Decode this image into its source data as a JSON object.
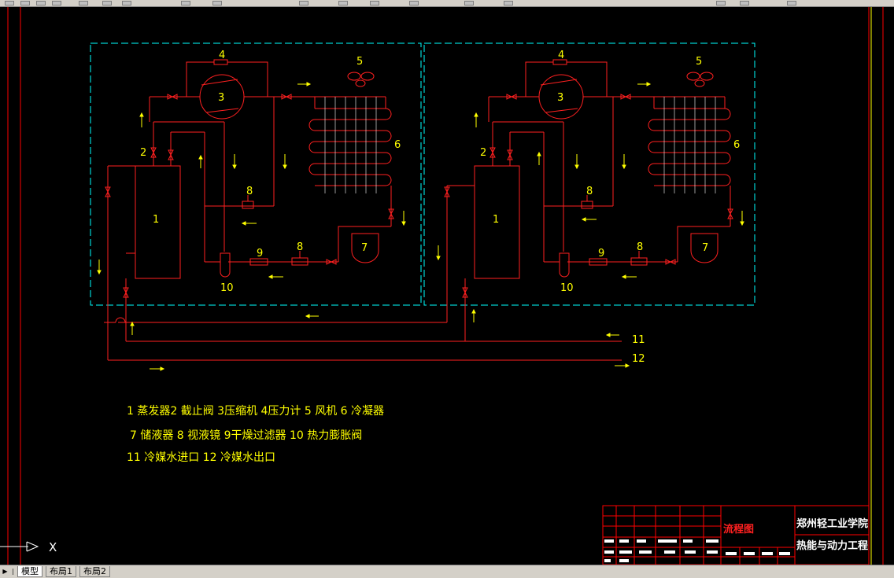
{
  "labels": {
    "n1": "1",
    "n2": "2",
    "n3": "3",
    "n4": "4",
    "n5": "5",
    "n6": "6",
    "n7": "7",
    "n8": "8",
    "n9": "9",
    "n10": "10",
    "n11": "11",
    "n12": "12"
  },
  "legend": [
    "1 蒸发器2 截止阀 3压缩机 4压力计 5 风机 6 冷凝器",
    "7 储液器 8 视液镜 9干燥过滤器 10 热力膨胀阀",
    "11 冷媒水进口 12 冷媒水出口"
  ],
  "title_block": {
    "drawing_title": "流程图",
    "school": "郑州轻工业学院",
    "major": "热能与动力工程"
  },
  "ucs": {
    "x_label": "X"
  },
  "tabs": [
    "模型",
    "布局1",
    "布局2"
  ],
  "colors": {
    "pipe": "#ff2020",
    "text": "#ffff00",
    "boundary": "#00ffff",
    "frame": "#ff0000",
    "white": "#ffffff"
  }
}
